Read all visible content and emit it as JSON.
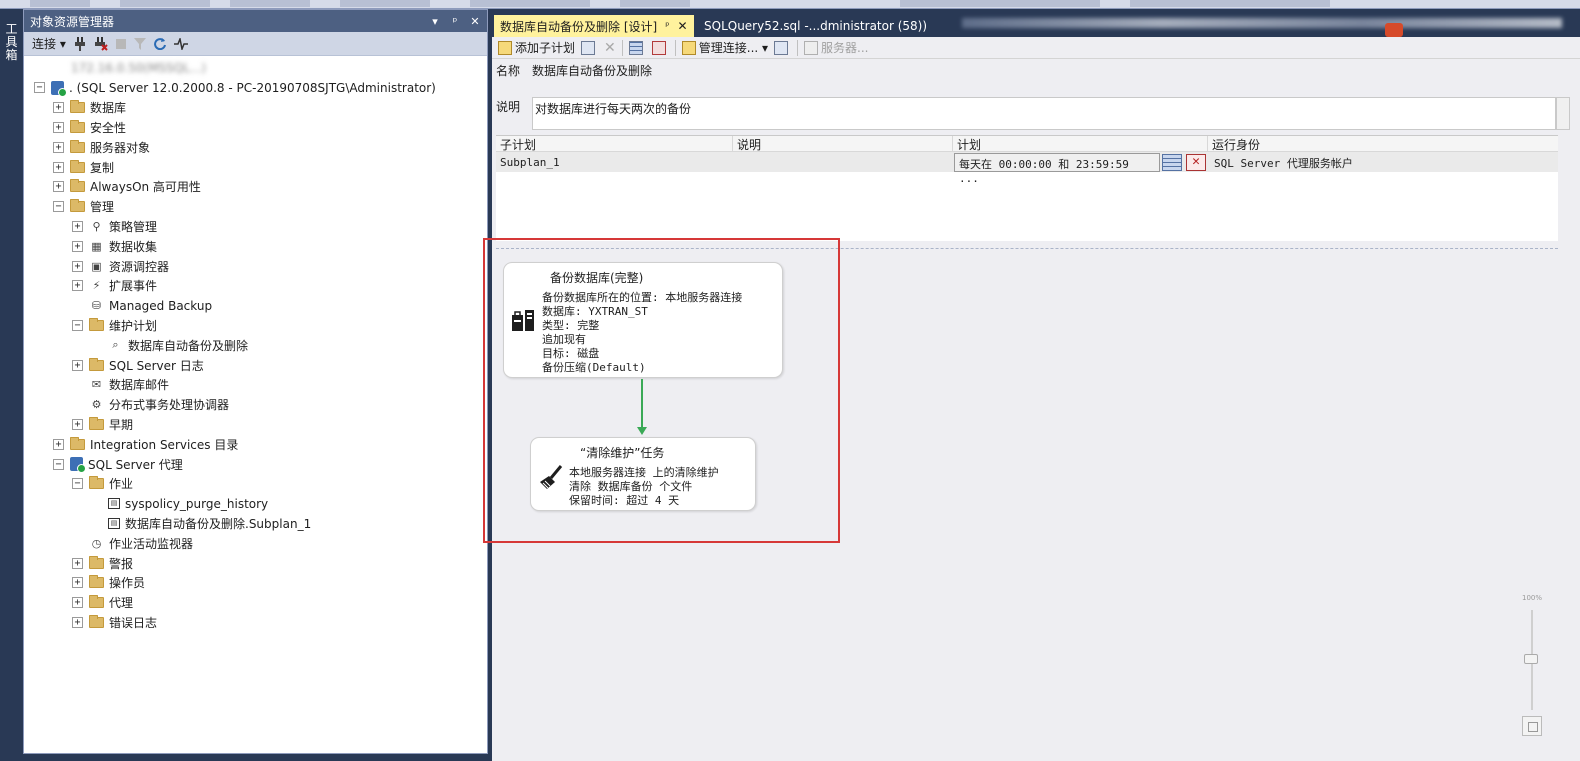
{
  "object_explorer": {
    "title": "对象资源管理器",
    "title_buttons": [
      "▾",
      "ᵖ",
      "✕"
    ],
    "toolbar": {
      "connect_label": "连接 ▾",
      "icons": [
        "connect-plug-icon",
        "disconnect-icon",
        "stop-icon",
        "filter-icon",
        "refresh-icon",
        "activity-monitor-icon"
      ]
    },
    "tree": [
      {
        "label": "172.16.0.50(MSSQL...)",
        "indent": 0,
        "expander": "none",
        "icon": "blur"
      },
      {
        "label": ". (SQL Server 12.0.2000.8 - PC-20190708SJTG\\Administrator)",
        "indent": 0,
        "expander": "−",
        "icon": "server"
      },
      {
        "label": "数据库",
        "indent": 1,
        "expander": "+",
        "icon": "folder"
      },
      {
        "label": "安全性",
        "indent": 1,
        "expander": "+",
        "icon": "folder"
      },
      {
        "label": "服务器对象",
        "indent": 1,
        "expander": "+",
        "icon": "folder"
      },
      {
        "label": "复制",
        "indent": 1,
        "expander": "+",
        "icon": "folder"
      },
      {
        "label": "AlwaysOn 高可用性",
        "indent": 1,
        "expander": "+",
        "icon": "folder"
      },
      {
        "label": "管理",
        "indent": 1,
        "expander": "−",
        "icon": "folder"
      },
      {
        "label": "策略管理",
        "indent": 2,
        "expander": "+",
        "icon": "policy"
      },
      {
        "label": "数据收集",
        "indent": 2,
        "expander": "+",
        "icon": "datacollect"
      },
      {
        "label": "资源调控器",
        "indent": 2,
        "expander": "+",
        "icon": "resource"
      },
      {
        "label": "扩展事件",
        "indent": 2,
        "expander": "+",
        "icon": "xevent"
      },
      {
        "label": "Managed Backup",
        "indent": 2,
        "expander": "none",
        "icon": "backup"
      },
      {
        "label": "维护计划",
        "indent": 2,
        "expander": "−",
        "icon": "folder"
      },
      {
        "label": "数据库自动备份及删除",
        "indent": 3,
        "expander": "none",
        "icon": "maintplan"
      },
      {
        "label": "SQL Server 日志",
        "indent": 2,
        "expander": "+",
        "icon": "folder"
      },
      {
        "label": "数据库邮件",
        "indent": 2,
        "expander": "none",
        "icon": "mail"
      },
      {
        "label": "分布式事务处理协调器",
        "indent": 2,
        "expander": "none",
        "icon": "dtc"
      },
      {
        "label": "早期",
        "indent": 2,
        "expander": "+",
        "icon": "folder"
      },
      {
        "label": "Integration Services 目录",
        "indent": 1,
        "expander": "+",
        "icon": "folder"
      },
      {
        "label": "SQL Server 代理",
        "indent": 1,
        "expander": "−",
        "icon": "agent"
      },
      {
        "label": "作业",
        "indent": 2,
        "expander": "−",
        "icon": "folder"
      },
      {
        "label": "syspolicy_purge_history",
        "indent": 3,
        "expander": "none",
        "icon": "job"
      },
      {
        "label": "数据库自动备份及删除.Subplan_1",
        "indent": 3,
        "expander": "none",
        "icon": "job"
      },
      {
        "label": "作业活动监视器",
        "indent": 2,
        "expander": "none",
        "icon": "jobmonitor"
      },
      {
        "label": "警报",
        "indent": 2,
        "expander": "+",
        "icon": "folder"
      },
      {
        "label": "操作员",
        "indent": 2,
        "expander": "+",
        "icon": "folder"
      },
      {
        "label": "代理",
        "indent": 2,
        "expander": "+",
        "icon": "folder"
      },
      {
        "label": "错误日志",
        "indent": 2,
        "expander": "+",
        "icon": "folder"
      }
    ]
  },
  "toolbox_strip": {
    "label": "工具箱"
  },
  "tabs": {
    "active": "数据库自动备份及删除 [设计]",
    "active_pin": "ᵖ",
    "active_close": "✕",
    "inactive": "SQLQuery52.sql -...dministrator (58))"
  },
  "designer_toolbar": {
    "add_subplan": "添加子计划",
    "manage_connections": "管理连接... ▾",
    "servers": "服务器..."
  },
  "plan": {
    "name_label": "名称",
    "name_value": "数据库自动备份及删除",
    "desc_label": "说明",
    "desc_value": "对数据库进行每天两次的备份"
  },
  "subplan_grid": {
    "headers": [
      "子计划",
      "说明",
      "计划",
      "运行身份"
    ],
    "row": {
      "subplan": "Subplan_1",
      "description": "",
      "schedule": "每天在 00:00:00 和 23:59:59 ...",
      "run_as": "SQL Server 代理服务帐户"
    }
  },
  "tasks": [
    {
      "title": "备份数据库(完整)",
      "icon": "backup-database-icon",
      "lines": [
        "备份数据库所在的位置: 本地服务器连接",
        "数据库: YXTRAN_ST",
        "类型: 完整",
        "追加现有",
        "目标: 磁盘",
        "备份压缩(Default)"
      ]
    },
    {
      "title": "“清除维护”任务",
      "icon": "cleanup-broom-icon",
      "lines": [
        "本地服务器连接 上的清除维护",
        "清除 数据库备份 个文件",
        "保留时间: 超过 4 天"
      ]
    }
  ],
  "zoom": {
    "label": "100%"
  },
  "colors": {
    "active_tab": "#fff29d",
    "frame": "#293955",
    "highlight_box": "#d63838",
    "connector": "#3aa956"
  }
}
